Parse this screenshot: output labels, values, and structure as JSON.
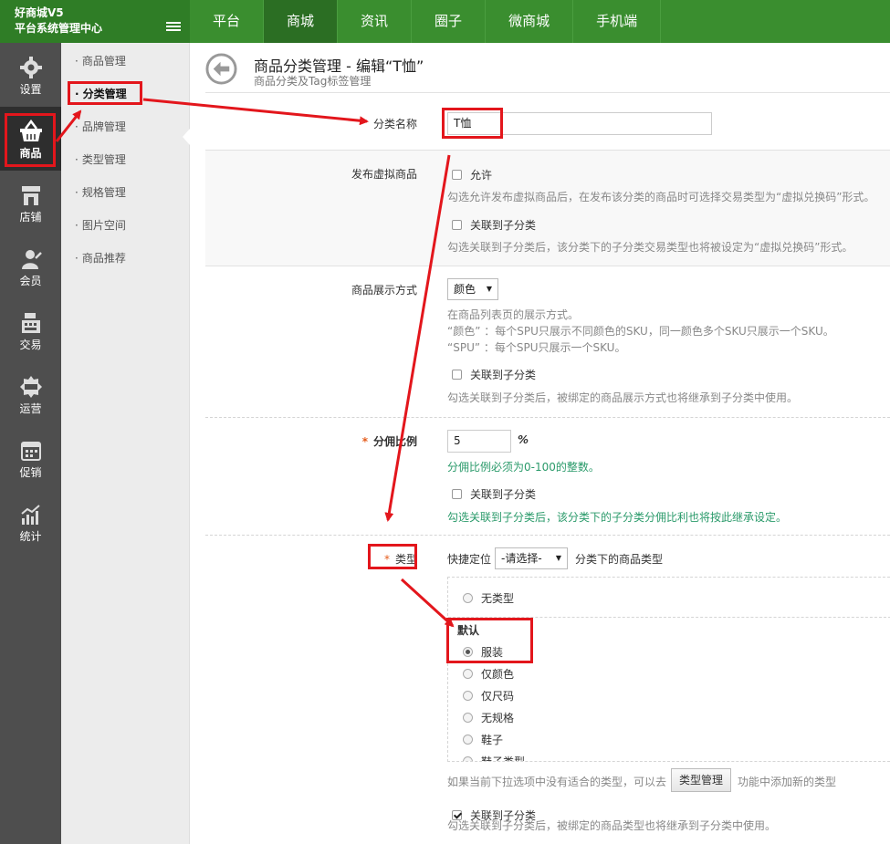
{
  "brand": {
    "line1": "好商城V5",
    "line2": "平台系统管理中心"
  },
  "topnav": {
    "tabs": [
      "平台",
      "商城",
      "资讯",
      "圈子",
      "微商城",
      "手机端"
    ],
    "active": "商城"
  },
  "sidebar": {
    "items": [
      {
        "label": "设置",
        "icon": "gear-icon"
      },
      {
        "label": "商品",
        "icon": "basket-icon"
      },
      {
        "label": "店铺",
        "icon": "store-icon"
      },
      {
        "label": "会员",
        "icon": "member-icon"
      },
      {
        "label": "交易",
        "icon": "cash-register-icon"
      },
      {
        "label": "运营",
        "icon": "sale-tag-icon"
      },
      {
        "label": "促销",
        "icon": "calendar-icon"
      },
      {
        "label": "统计",
        "icon": "chart-icon"
      }
    ],
    "active": "商品"
  },
  "submenu": {
    "items": [
      "商品管理",
      "分类管理",
      "品牌管理",
      "类型管理",
      "规格管理",
      "图片空间",
      "商品推荐"
    ],
    "active": "分类管理"
  },
  "page": {
    "title": "商品分类管理 - 编辑“T恤”",
    "subtitle": "商品分类及Tag标签管理"
  },
  "form": {
    "name": {
      "label": "分类名称",
      "value": "T恤"
    },
    "virtual": {
      "label": "发布虚拟商品",
      "allow_label": "允许",
      "allow_hint": "勾选允许发布虚拟商品后，在发布该分类的商品时可选择交易类型为“虚拟兑换码”形式。",
      "sub_label": "关联到子分类",
      "sub_hint": "勾选关联到子分类后，该分类下的子分类交易类型也将被设定为“虚拟兑换码”形式。"
    },
    "display": {
      "label": "商品展示方式",
      "value": "颜色",
      "hint1": "在商品列表页的展示方式。",
      "hint2": "“颜色” ：每个SPU只展示不同颜色的SKU，同一颜色多个SKU只展示一个SKU。",
      "hint3": "“SPU” ：每个SPU只展示一个SKU。",
      "sub_label": "关联到子分类",
      "sub_hint": "勾选关联到子分类后，被绑定的商品展示方式也将继承到子分类中使用。"
    },
    "commission": {
      "required": "*",
      "label": "分佣比例",
      "value": "5",
      "unit": "%",
      "hint": "分佣比例必须为0-100的整数。",
      "sub_label": "关联到子分类",
      "sub_hint": "勾选关联到子分类后，该分类下的子分类分佣比利也将按此继承设定。"
    },
    "type": {
      "required": "*",
      "label": "类型",
      "quick_label": "快捷定位",
      "select_value": "-请选择-",
      "after_label": "分类下的商品类型",
      "none_option": "无类型",
      "group": "默认",
      "options": [
        "服装",
        "仅颜色",
        "仅尺码",
        "无规格",
        "鞋子",
        "鞋子类型"
      ],
      "selected": "服装",
      "hint_before": "如果当前下拉选项中没有适合的类型，可以去",
      "button": "类型管理",
      "hint_after": "功能中添加新的类型",
      "sub_label": "关联到子分类",
      "sub_checked": true,
      "sub_hint": "勾选关联到子分类后，被绑定的商品类型也将继承到子分类中使用。"
    }
  },
  "colors": {
    "topbar": "#3a8e2f",
    "sidebar": "#4e4e4e",
    "annotation": "#e3161c",
    "required": "#e55b1a"
  }
}
